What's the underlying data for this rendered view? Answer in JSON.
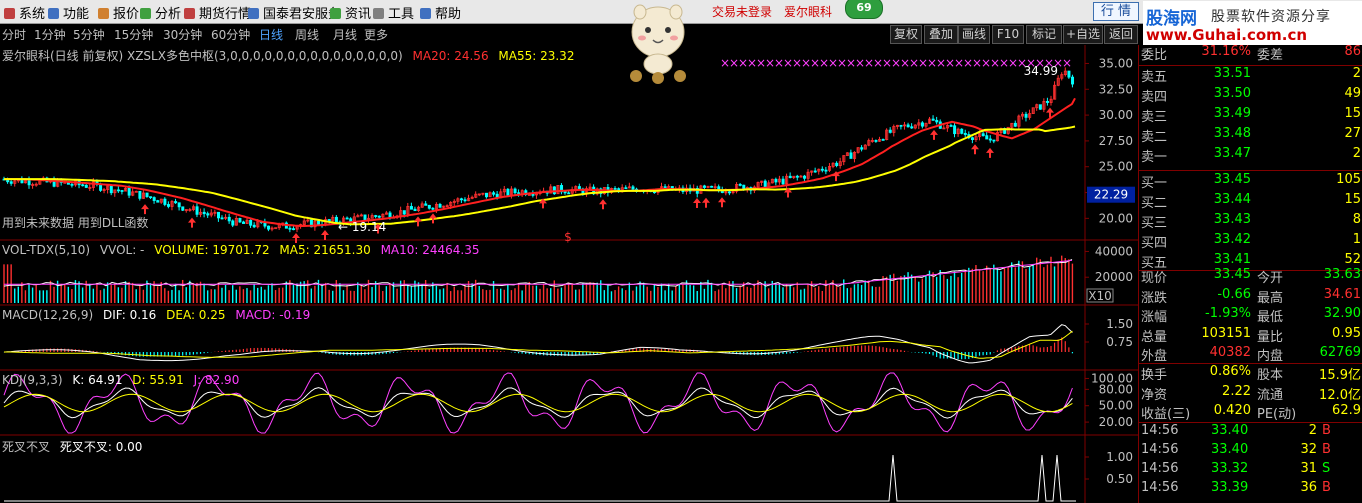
{
  "menu": [
    "系统",
    "功能",
    "报价",
    "分析",
    "期货行情",
    "国泰君安服务",
    "资讯",
    "工具",
    "帮助"
  ],
  "login_status": "交易未登录",
  "stock_name": "爱尔眼科",
  "badge": "69",
  "hangqing_button": "行 情",
  "logo": {
    "part1": "股海网",
    "part2": "股票软件资源分享",
    "part3": "www.Guhai.com.cn"
  },
  "toolbar": {
    "periods": [
      "分时",
      "1分钟",
      "5分钟",
      "15分钟",
      "30分钟",
      "60分钟",
      "日线",
      "周线",
      "月线",
      "更多"
    ],
    "active": "日线",
    "right": [
      "复权",
      "叠加",
      "画线",
      "F10",
      "标记",
      "+自选",
      "返回"
    ]
  },
  "main_panel": {
    "title": "爱尔眼科(日线 前复权) XZSLX多色中枢(3,0,0,0,0,0,0,0,0,0,0,0,0,0,0,0)",
    "ma20": "MA20: 24.56",
    "ma55": "MA55: 23.32",
    "y_ticks": [
      "35.00",
      "32.50",
      "30.00",
      "27.50",
      "25.00",
      "22.50",
      "20.00"
    ],
    "y_range": [
      18.0,
      36.4
    ],
    "current_price": "22.29",
    "high_label": "34.99",
    "low_label": "19.14",
    "note": "用到未来数据 用到DLL函数",
    "marker": "$",
    "colors": {
      "ma20": "#ff2020",
      "ma55": "#ffff00",
      "up": "#ff3030",
      "down": "#00ffff"
    }
  },
  "vol_panel": {
    "name": "VOL-TDX(5,10)",
    "vvol": "VVOL: -",
    "volume": "VOLUME: 19701.72",
    "ma5": "MA5: 21651.30",
    "ma10": "MA10: 24464.35",
    "y_ticks": [
      "40000",
      "20000"
    ],
    "unit": "X10"
  },
  "macd_panel": {
    "name": "MACD(12,26,9)",
    "dif": "DIF: 0.16",
    "dea": "DEA: 0.25",
    "macd": "MACD: -0.19",
    "y_ticks": [
      "1.50",
      "0.75"
    ]
  },
  "kdj_panel": {
    "name": "KDJ(9,3,3)",
    "k": "K: 64.91",
    "d": "D: 55.91",
    "j": "J: 82.90",
    "y_ticks": [
      "100.00",
      "80.00",
      "50.00",
      "20.00"
    ]
  },
  "cross_panel": {
    "name": "死叉不叉",
    "value": "死叉不叉: 0.00",
    "y_ticks": [
      "1.00",
      "0.50"
    ]
  },
  "quote": {
    "weibi": {
      "label": "委比",
      "value": "31.16%",
      "label2": "委差",
      "value2": "86"
    },
    "sells": [
      {
        "label": "卖五",
        "price": "33.51",
        "vol": "2"
      },
      {
        "label": "卖四",
        "price": "33.50",
        "vol": "49"
      },
      {
        "label": "卖三",
        "price": "33.49",
        "vol": "15"
      },
      {
        "label": "卖二",
        "price": "33.48",
        "vol": "27"
      },
      {
        "label": "卖一",
        "price": "33.47",
        "vol": "2"
      }
    ],
    "buys": [
      {
        "label": "买一",
        "price": "33.45",
        "vol": "105"
      },
      {
        "label": "买二",
        "price": "33.44",
        "vol": "15"
      },
      {
        "label": "买三",
        "price": "33.43",
        "vol": "8"
      },
      {
        "label": "买四",
        "price": "33.42",
        "vol": "1"
      },
      {
        "label": "买五",
        "price": "33.41",
        "vol": "52"
      }
    ],
    "stats": [
      {
        "l1": "现价",
        "v1": "33.45",
        "c1": "#00ff00",
        "l2": "今开",
        "v2": "33.63",
        "c2": "#00ff00"
      },
      {
        "l1": "涨跌",
        "v1": "-0.66",
        "c1": "#00ff00",
        "l2": "最高",
        "v2": "34.61",
        "c2": "#ff3030"
      },
      {
        "l1": "涨幅",
        "v1": "-1.93%",
        "c1": "#00ff00",
        "l2": "最低",
        "v2": "32.90",
        "c2": "#00ff00"
      },
      {
        "l1": "总量",
        "v1": "103151",
        "c1": "#ffff00",
        "l2": "量比",
        "v2": "0.95",
        "c2": "#ffff00"
      },
      {
        "l1": "外盘",
        "v1": "40382",
        "c1": "#ff3030",
        "l2": "内盘",
        "v2": "62769",
        "c2": "#00ff00"
      }
    ],
    "stats2": [
      {
        "l1": "换手",
        "v1": "0.86%",
        "c1": "#ffff00",
        "l2": "股本",
        "v2": "15.9亿",
        "c2": "#ffff00"
      },
      {
        "l1": "净资",
        "v1": "2.22",
        "c1": "#ffff00",
        "l2": "流通",
        "v2": "12.0亿",
        "c2": "#ffff00"
      },
      {
        "l1": "收益(三)",
        "v1": "0.420",
        "c1": "#ffff00",
        "l2": "PE(动)",
        "v2": "62.9",
        "c2": "#ffff00"
      }
    ],
    "ticks": [
      {
        "time": "14:56",
        "price": "33.40",
        "vol": "2",
        "side": "B"
      },
      {
        "time": "14:56",
        "price": "33.40",
        "vol": "32",
        "side": "B"
      },
      {
        "time": "14:56",
        "price": "33.32",
        "vol": "31",
        "side": "S"
      },
      {
        "time": "14:56",
        "price": "33.39",
        "vol": "36",
        "side": "B"
      }
    ]
  }
}
